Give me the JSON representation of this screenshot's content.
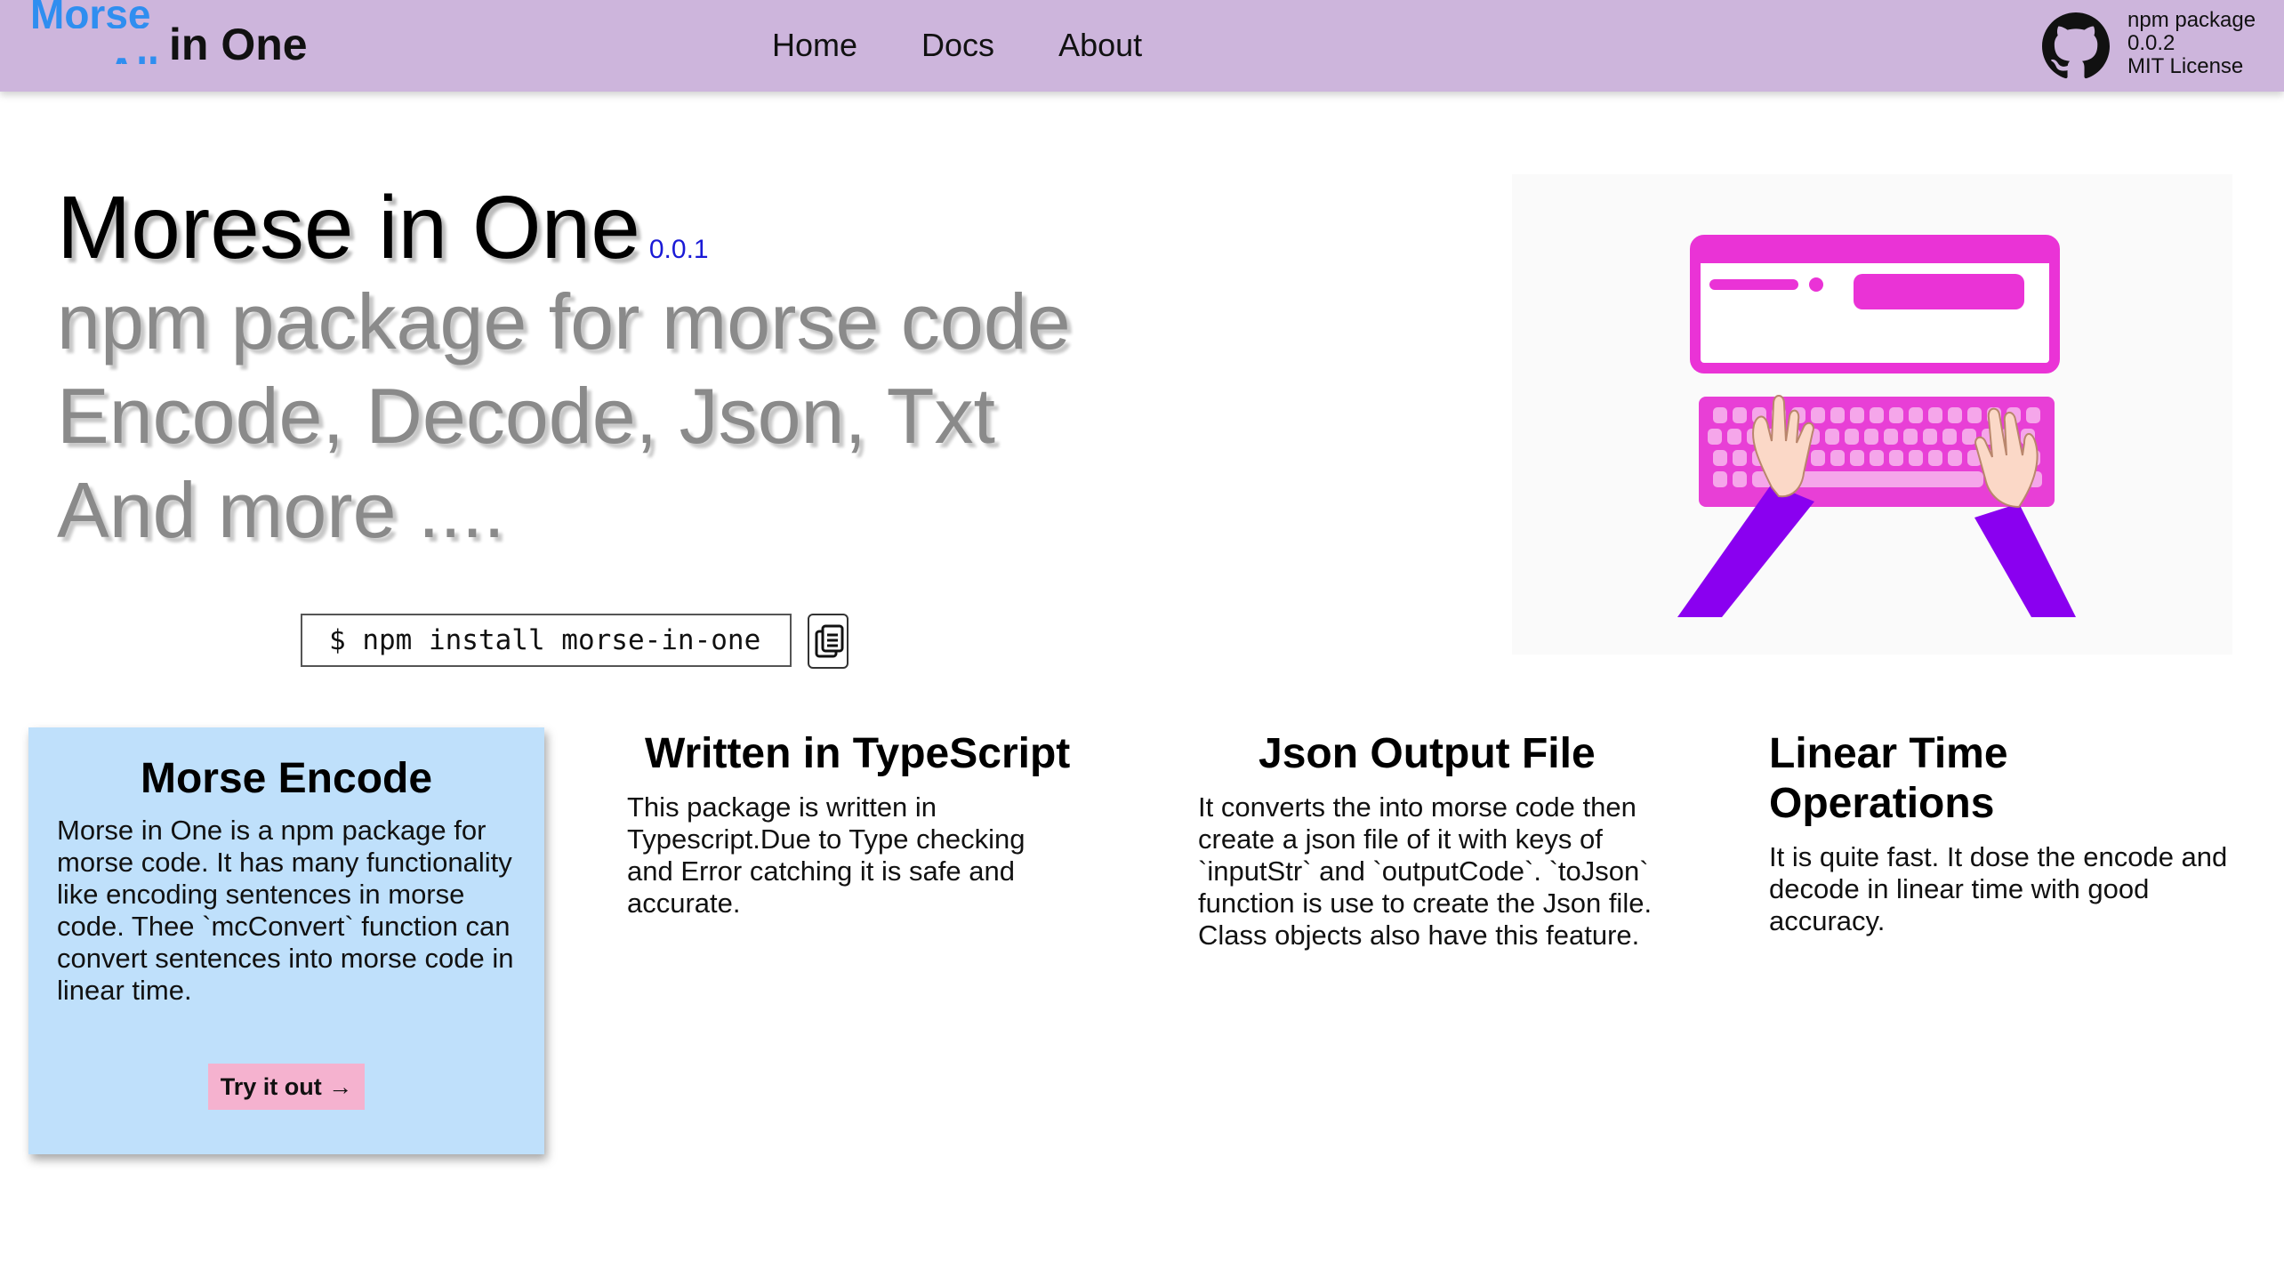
{
  "header": {
    "logo": {
      "word_top": "Morse",
      "word_bottom": "All",
      "word_main": "in One"
    },
    "nav": [
      "Home",
      "Docs",
      "About"
    ],
    "package_info": [
      "npm package",
      "0.0.2",
      "MIT License"
    ],
    "github_icon": "github-icon"
  },
  "hero": {
    "title": "Morese in One",
    "version": "0.0.1",
    "subtitle_lines": [
      "npm package for morse code",
      "Encode, Decode, Json, Txt",
      "And more ...."
    ],
    "install_command": "$ npm install morse-in-one",
    "copy_icon": "clipboard-icon"
  },
  "illustration": {
    "description_icon": "typing-on-keyboard-illustration",
    "colors": {
      "accent": "#ea33d6",
      "arm": "#8a00f0",
      "skin": "#fbd8c7"
    }
  },
  "cards": [
    {
      "title": "Morse Encode",
      "body": "Morse in One is a npm package for morse code. It has many functionality like encoding sentences in morse code. Thee `mcConvert` function can convert sentences into morse code in linear time.",
      "button": "Try it out →"
    },
    {
      "title": "Written in TypeScript",
      "body": "This package is written in Typescript.Due to Type checking and Error catching it is safe and accurate."
    },
    {
      "title": "Json Output File",
      "body": "It converts the into morse code then create a json file of it with keys of `inputStr` and `outputCode`. `toJson` function is use to create the Json file. Class objects also have this feature."
    },
    {
      "title": "Linear Time Operations",
      "body": "It is quite fast. It dose the encode and decode in linear time with good accuracy."
    }
  ],
  "colors": {
    "header_bg": "#cdb5dc",
    "logo_blue": "#2f8ef0",
    "version_blue": "#1a1ad6",
    "card_highlight": "#bfe0fb",
    "button_pink": "#f5b2cf"
  }
}
